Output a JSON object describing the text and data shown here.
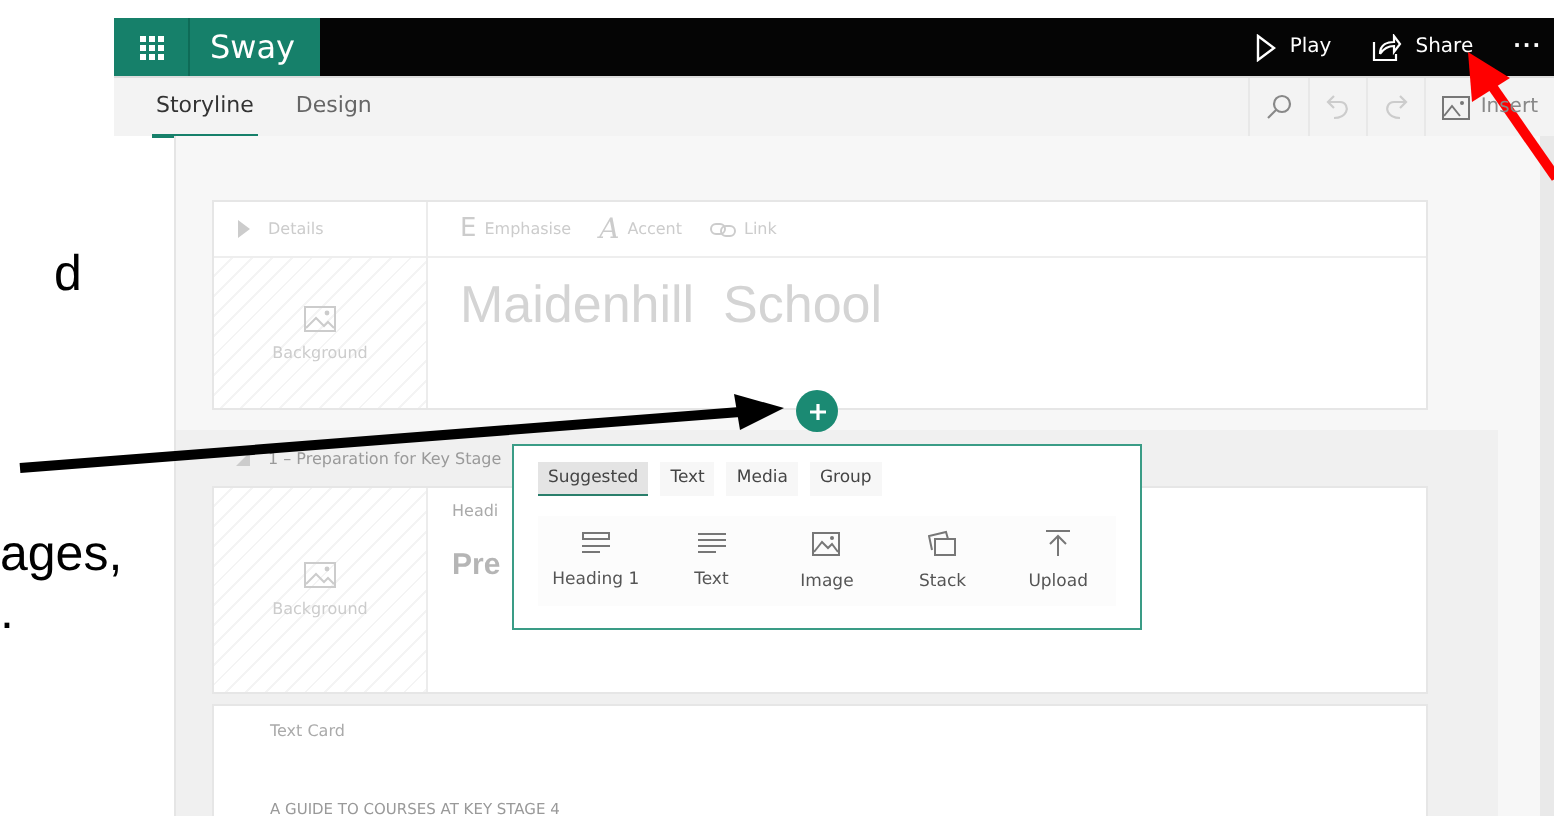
{
  "slide_text": [
    "d",
    "ages,",
    "."
  ],
  "app": {
    "title": "Sway"
  },
  "top_actions": [
    {
      "kind": "play",
      "label": "Play"
    },
    {
      "kind": "share",
      "label": "Share"
    },
    {
      "kind": "more",
      "label": "···"
    }
  ],
  "tabs": [
    {
      "label": "Storyline",
      "selected": true
    },
    {
      "label": "Design",
      "selected": false
    }
  ],
  "toolbar": [
    {
      "kind": "search"
    },
    {
      "kind": "undo"
    },
    {
      "kind": "redo"
    },
    {
      "kind": "insert",
      "label": "Insert"
    }
  ],
  "title_card": {
    "details": "Details",
    "background": "Background",
    "formats": [
      {
        "glyph": "E",
        "label": "Emphasise",
        "kind": "emphasise"
      },
      {
        "glyph": "A",
        "label": "Accent",
        "kind": "accent"
      },
      {
        "label": "Link",
        "kind": "link"
      }
    ],
    "title": "Maidenhill  School"
  },
  "section": {
    "heading": "1 – Preparation for Key Stage",
    "background": "Background",
    "label": "Headi",
    "title": "Pre"
  },
  "text_card": {
    "label": "Text Card",
    "body": "A GUIDE TO COURSES AT KEY STAGE 4"
  },
  "insert_menu": {
    "tabs": [
      {
        "label": "Suggested",
        "selected": true
      },
      {
        "label": "Text",
        "selected": false
      },
      {
        "label": "Media",
        "selected": false
      },
      {
        "label": "Group",
        "selected": false
      }
    ],
    "items": [
      {
        "kind": "heading",
        "label": "Heading 1"
      },
      {
        "kind": "text",
        "label": "Text"
      },
      {
        "kind": "image",
        "label": "Image"
      },
      {
        "kind": "stack",
        "label": "Stack"
      },
      {
        "kind": "upload",
        "label": "Upload"
      }
    ]
  }
}
